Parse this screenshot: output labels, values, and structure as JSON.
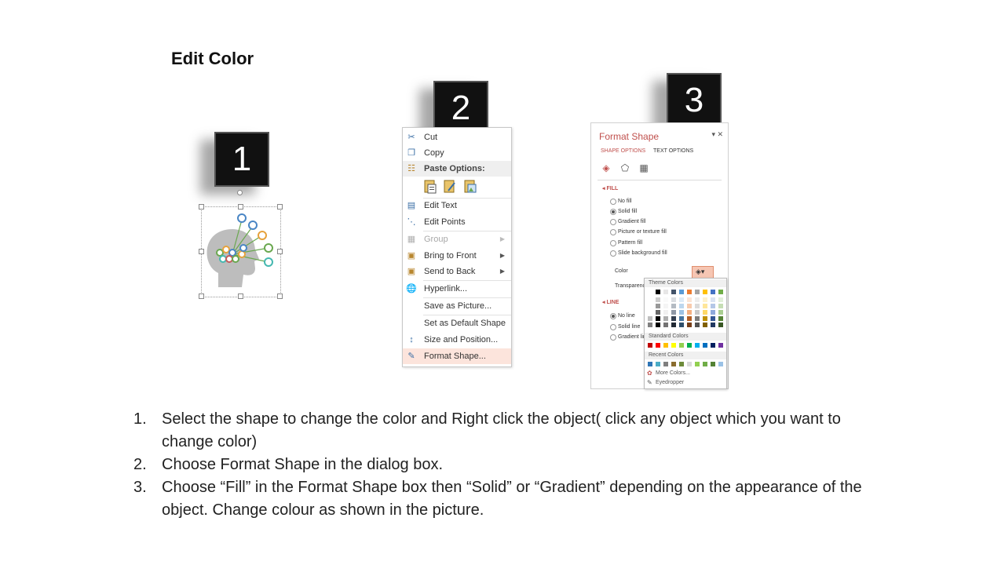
{
  "slide": {
    "title": "Edit Color"
  },
  "steps": [
    "1",
    "2",
    "3"
  ],
  "context_menu": {
    "items": [
      {
        "label": "Cut",
        "icon": "scissors-icon"
      },
      {
        "label": "Copy",
        "icon": "copy-icon"
      },
      {
        "label": "Paste Options:",
        "icon": "paste-icon"
      },
      {
        "label": "Edit Text",
        "icon": "edit-text-icon"
      },
      {
        "label": "Edit Points",
        "icon": "edit-points-icon"
      },
      {
        "label": "Group",
        "icon": "group-icon"
      },
      {
        "label": "Bring to Front",
        "icon": "bring-front-icon"
      },
      {
        "label": "Send to Back",
        "icon": "send-back-icon"
      },
      {
        "label": "Hyperlink...",
        "icon": "hyperlink-icon"
      },
      {
        "label": "Save as Picture...",
        "icon": ""
      },
      {
        "label": "Set as Default Shape",
        "icon": ""
      },
      {
        "label": "Size and Position...",
        "icon": "size-position-icon"
      },
      {
        "label": "Format Shape...",
        "icon": "format-shape-icon"
      }
    ]
  },
  "format_pane": {
    "title": "Format Shape",
    "tabs": [
      "SHAPE OPTIONS",
      "TEXT OPTIONS"
    ],
    "fill_header": "FILL",
    "fill_options": [
      "No fill",
      "Solid fill",
      "Gradient fill",
      "Picture or texture fill",
      "Pattern fill",
      "Slide background fill"
    ],
    "color_label": "Color",
    "transparency_label": "Transparency",
    "line_header": "LINE",
    "line_options": [
      "No line",
      "Solid line",
      "Gradient line"
    ]
  },
  "palette": {
    "theme_header": "Theme Colors",
    "standard_header": "Standard Colors",
    "recent_header": "Recent Colors",
    "more_colors": "More Colors...",
    "eyedropper": "Eyedropper",
    "theme_top": [
      "#ffffff",
      "#000000",
      "#e7e6e6",
      "#44546a",
      "#5b9bd5",
      "#ed7d31",
      "#a5a5a5",
      "#ffc000",
      "#4472c4",
      "#70ad47"
    ],
    "standard": [
      "#c00000",
      "#ff0000",
      "#ffc000",
      "#ffff00",
      "#92d050",
      "#00b050",
      "#00b0f0",
      "#0070c0",
      "#002060",
      "#7030a0"
    ],
    "recent": [
      "#2e75b6",
      "#4bacc6",
      "#7f7f7f",
      "#8b6d2f",
      "#6d8b3a",
      "#d9d9d9",
      "#92d050",
      "#70ad47",
      "#548235",
      "#9bc2e6"
    ]
  },
  "instructions": [
    {
      "num": "1.",
      "text": "Select the shape to change the color and Right click the object( click any object which you want to change color)"
    },
    {
      "num": "2.",
      "text": "Choose Format Shape in the dialog box."
    },
    {
      "num": "3.",
      "text": "Choose “Fill” in the Format Shape box then “Solid” or “Gradient” depending on the appearance of the object. Change colour as shown in the picture."
    }
  ]
}
